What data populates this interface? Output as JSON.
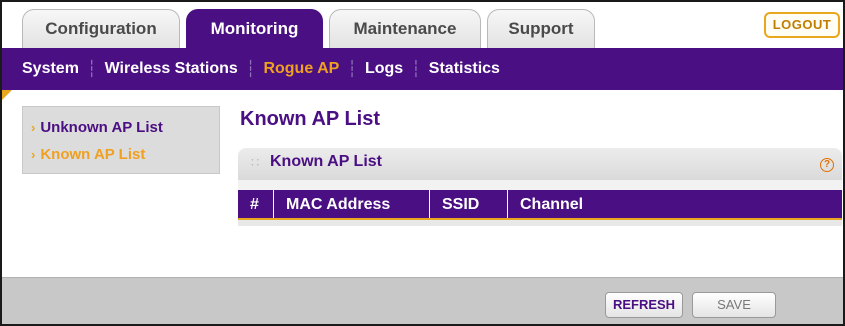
{
  "header": {
    "tabs": [
      {
        "label": "Configuration",
        "active": false
      },
      {
        "label": "Monitoring",
        "active": true
      },
      {
        "label": "Maintenance",
        "active": false
      },
      {
        "label": "Support",
        "active": false
      }
    ],
    "logout_label": "LOGOUT"
  },
  "subnav": {
    "items": [
      {
        "label": "System",
        "active": false
      },
      {
        "label": "Wireless Stations",
        "active": false
      },
      {
        "label": "Rogue AP",
        "active": true
      },
      {
        "label": "Logs",
        "active": false
      },
      {
        "label": "Statistics",
        "active": false
      }
    ]
  },
  "sidebar": {
    "items": [
      {
        "label": "Unknown AP List",
        "active": false
      },
      {
        "label": "Known AP List",
        "active": true
      }
    ]
  },
  "main": {
    "title": "Known AP List",
    "panel": {
      "title": "Known AP List",
      "help_glyph": "?",
      "columns": [
        "#",
        "MAC Address",
        "SSID",
        "Channel"
      ]
    }
  },
  "footer": {
    "refresh_label": "REFRESH",
    "save_label": "SAVE"
  },
  "colors": {
    "brand_purple": "#4a0f82",
    "accent_orange": "#f0a020"
  }
}
